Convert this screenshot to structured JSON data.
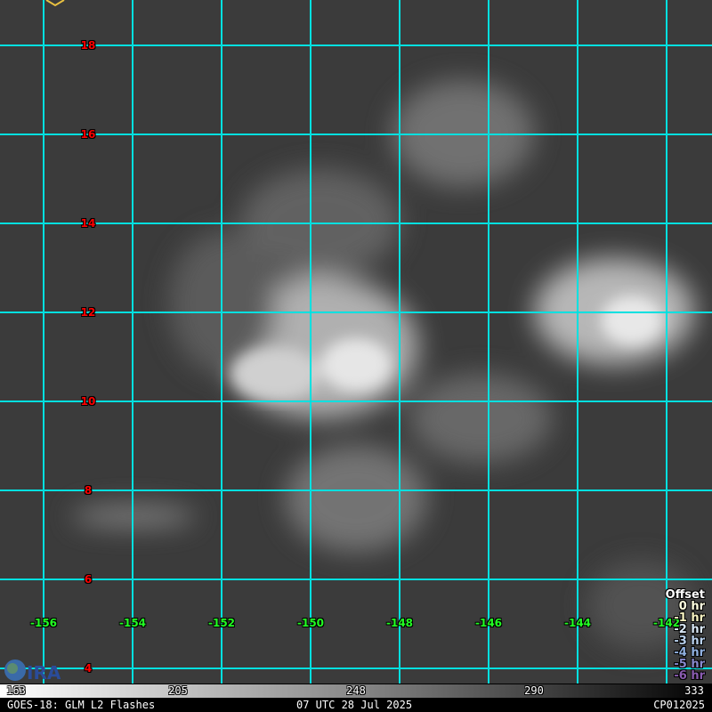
{
  "latitudes": [
    "18",
    "16",
    "14",
    "12",
    "10",
    "8",
    "6",
    "4"
  ],
  "longitudes": [
    "-156",
    "-154",
    "-152",
    "-150",
    "-148",
    "-146",
    "-144",
    "-142"
  ],
  "legend": {
    "title": "Offset",
    "items": [
      {
        "label": "0 hr",
        "color": "#ffffe0"
      },
      {
        "label": "-1 hr",
        "color": "#f4f0c0"
      },
      {
        "label": "-2 hr",
        "color": "#d8e6f4"
      },
      {
        "label": "-3 hr",
        "color": "#b8d0ec"
      },
      {
        "label": "-4 hr",
        "color": "#90b0e0"
      },
      {
        "label": "-5 hr",
        "color": "#8888cc"
      },
      {
        "label": "-6 hr",
        "color": "#8a5cb0"
      }
    ]
  },
  "colorbar": {
    "ticks": [
      "163",
      "205",
      "248",
      "290",
      "333"
    ]
  },
  "status": {
    "product": "GOES-18: GLM L2 Flashes",
    "time": "07 UTC 28 Jul 2025",
    "storm": "CP012025"
  },
  "logo": "CIRA",
  "colors": {
    "grid": "#00e0e0",
    "lat_label": "#ff0000",
    "lon_label": "#22ff22"
  }
}
